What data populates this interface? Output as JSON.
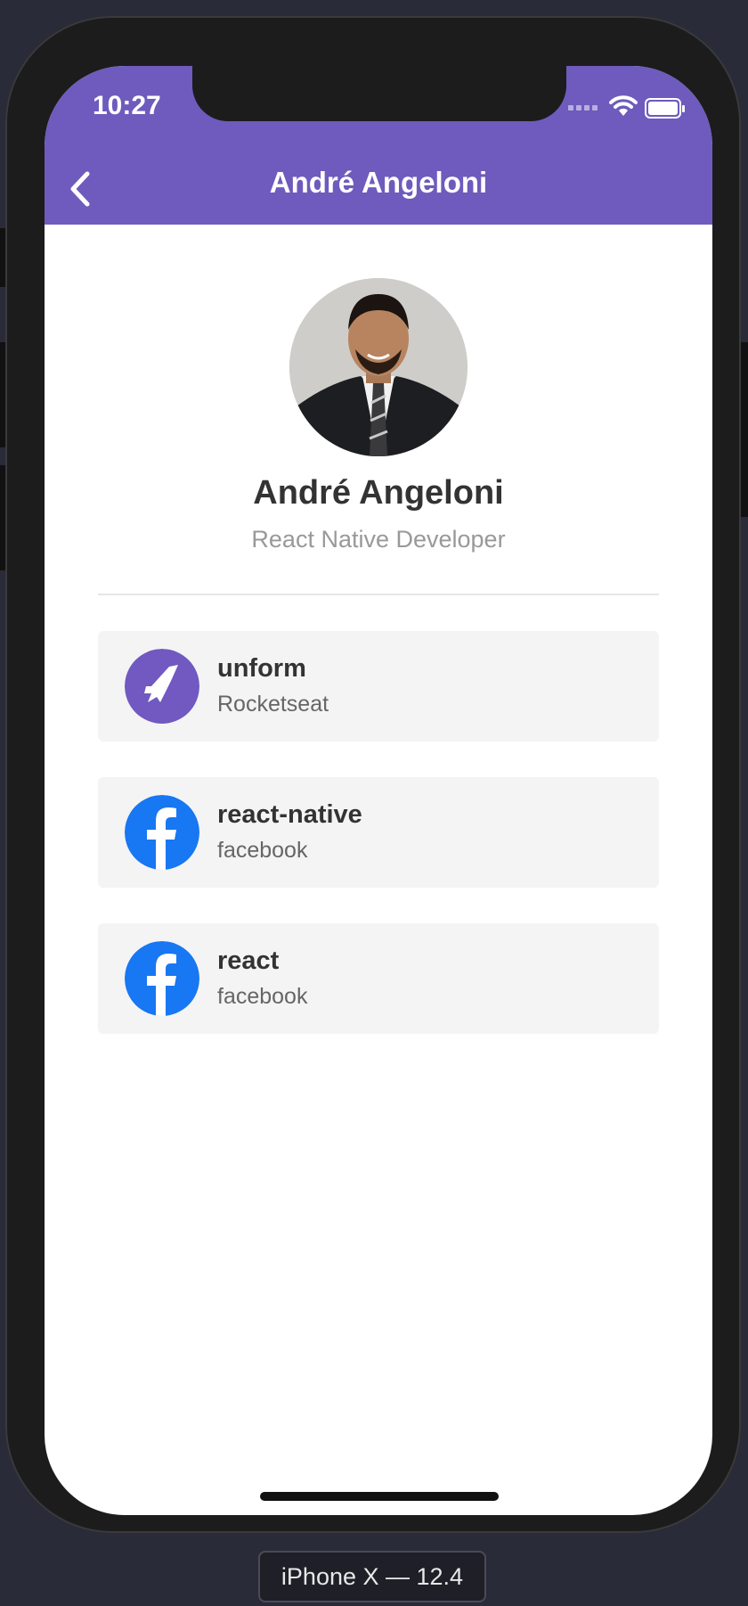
{
  "status_bar": {
    "time": "10:27"
  },
  "nav": {
    "title": "André Angeloni"
  },
  "profile": {
    "name": "André Angeloni",
    "bio": "React Native Developer"
  },
  "repos": [
    {
      "name": "unform",
      "owner": "Rocketseat",
      "icon": "rocketseat-logo-icon",
      "color": "#7159c1"
    },
    {
      "name": "react-native",
      "owner": "facebook",
      "icon": "facebook-logo-icon",
      "color": "#1877f2"
    },
    {
      "name": "react",
      "owner": "facebook",
      "icon": "facebook-logo-icon",
      "color": "#1877f2"
    }
  ],
  "device_label": "iPhone X — 12.4",
  "colors": {
    "header": "#6e5bbd",
    "card": "#f4f4f4",
    "text": "#333333",
    "muted": "#999999"
  }
}
